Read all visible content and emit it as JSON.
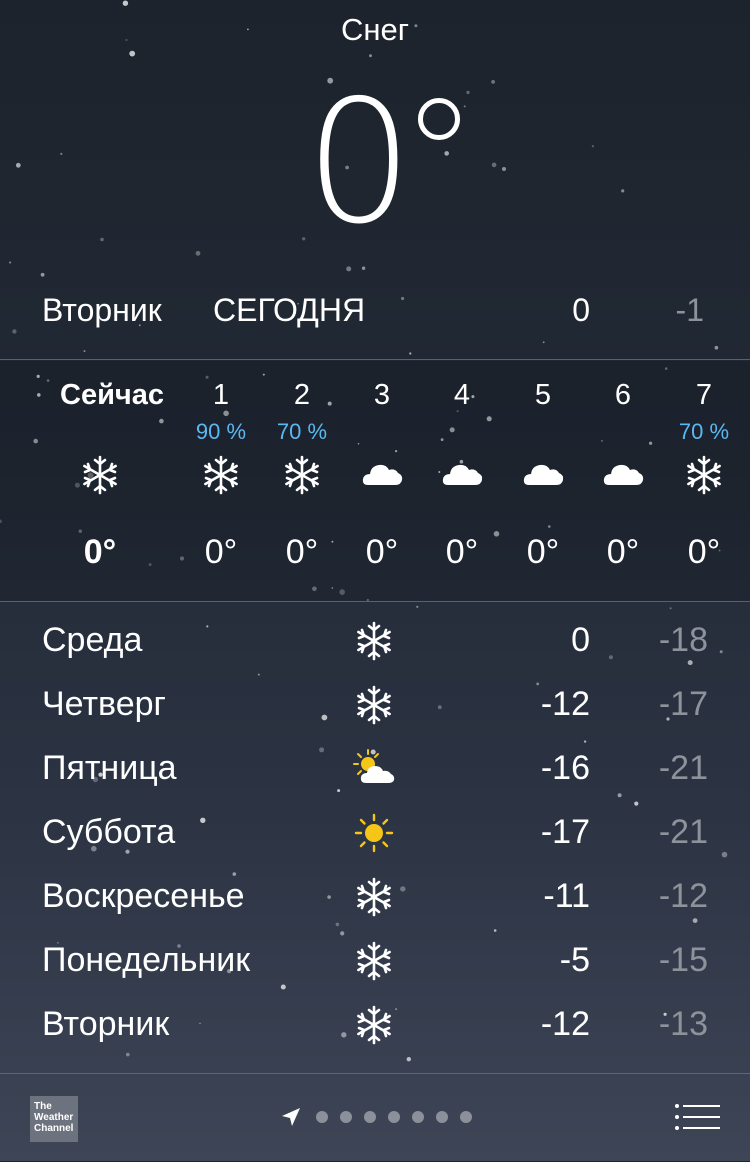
{
  "current": {
    "condition": "Снег",
    "temperature": "0"
  },
  "today": {
    "day": "Вторник",
    "label": "сегодня",
    "high": "0",
    "low": "-1"
  },
  "hourly": [
    {
      "time": "Сейчас",
      "pop": "",
      "icon": "snowflake-icon",
      "temp": "0°"
    },
    {
      "time": "1",
      "pop": "90 %",
      "icon": "snowflake-icon",
      "temp": "0°"
    },
    {
      "time": "2",
      "pop": "70 %",
      "icon": "snowflake-icon",
      "temp": "0°"
    },
    {
      "time": "3",
      "pop": "",
      "icon": "cloud-icon",
      "temp": "0°"
    },
    {
      "time": "4",
      "pop": "",
      "icon": "cloud-icon",
      "temp": "0°"
    },
    {
      "time": "5",
      "pop": "",
      "icon": "cloud-icon",
      "temp": "0°"
    },
    {
      "time": "6",
      "pop": "",
      "icon": "cloud-icon",
      "temp": "0°"
    },
    {
      "time": "7",
      "pop": "70 %",
      "icon": "snowflake-icon",
      "temp": "0°"
    }
  ],
  "daily": [
    {
      "day": "Среда",
      "icon": "snowflake-icon",
      "high": "0",
      "low": "-18"
    },
    {
      "day": "Четверг",
      "icon": "snowflake-icon",
      "high": "-12",
      "low": "-17"
    },
    {
      "day": "Пятница",
      "icon": "sun-cloud-icon",
      "high": "-16",
      "low": "-21"
    },
    {
      "day": "Суббота",
      "icon": "sun-icon",
      "high": "-17",
      "low": "-21"
    },
    {
      "day": "Воскресенье",
      "icon": "snowflake-icon",
      "high": "-11",
      "low": "-12"
    },
    {
      "day": "Понедельник",
      "icon": "snowflake-icon",
      "high": "-5",
      "low": "-15"
    },
    {
      "day": "Вторник",
      "icon": "snowflake-icon",
      "high": "-12",
      "low": "-13"
    }
  ],
  "footer": {
    "logo_text": "The Weather Channel",
    "page_count": 7
  },
  "colors": {
    "precip": "#5ab8f0",
    "low_temp": "#8e939b",
    "sun": "#f5c518"
  }
}
